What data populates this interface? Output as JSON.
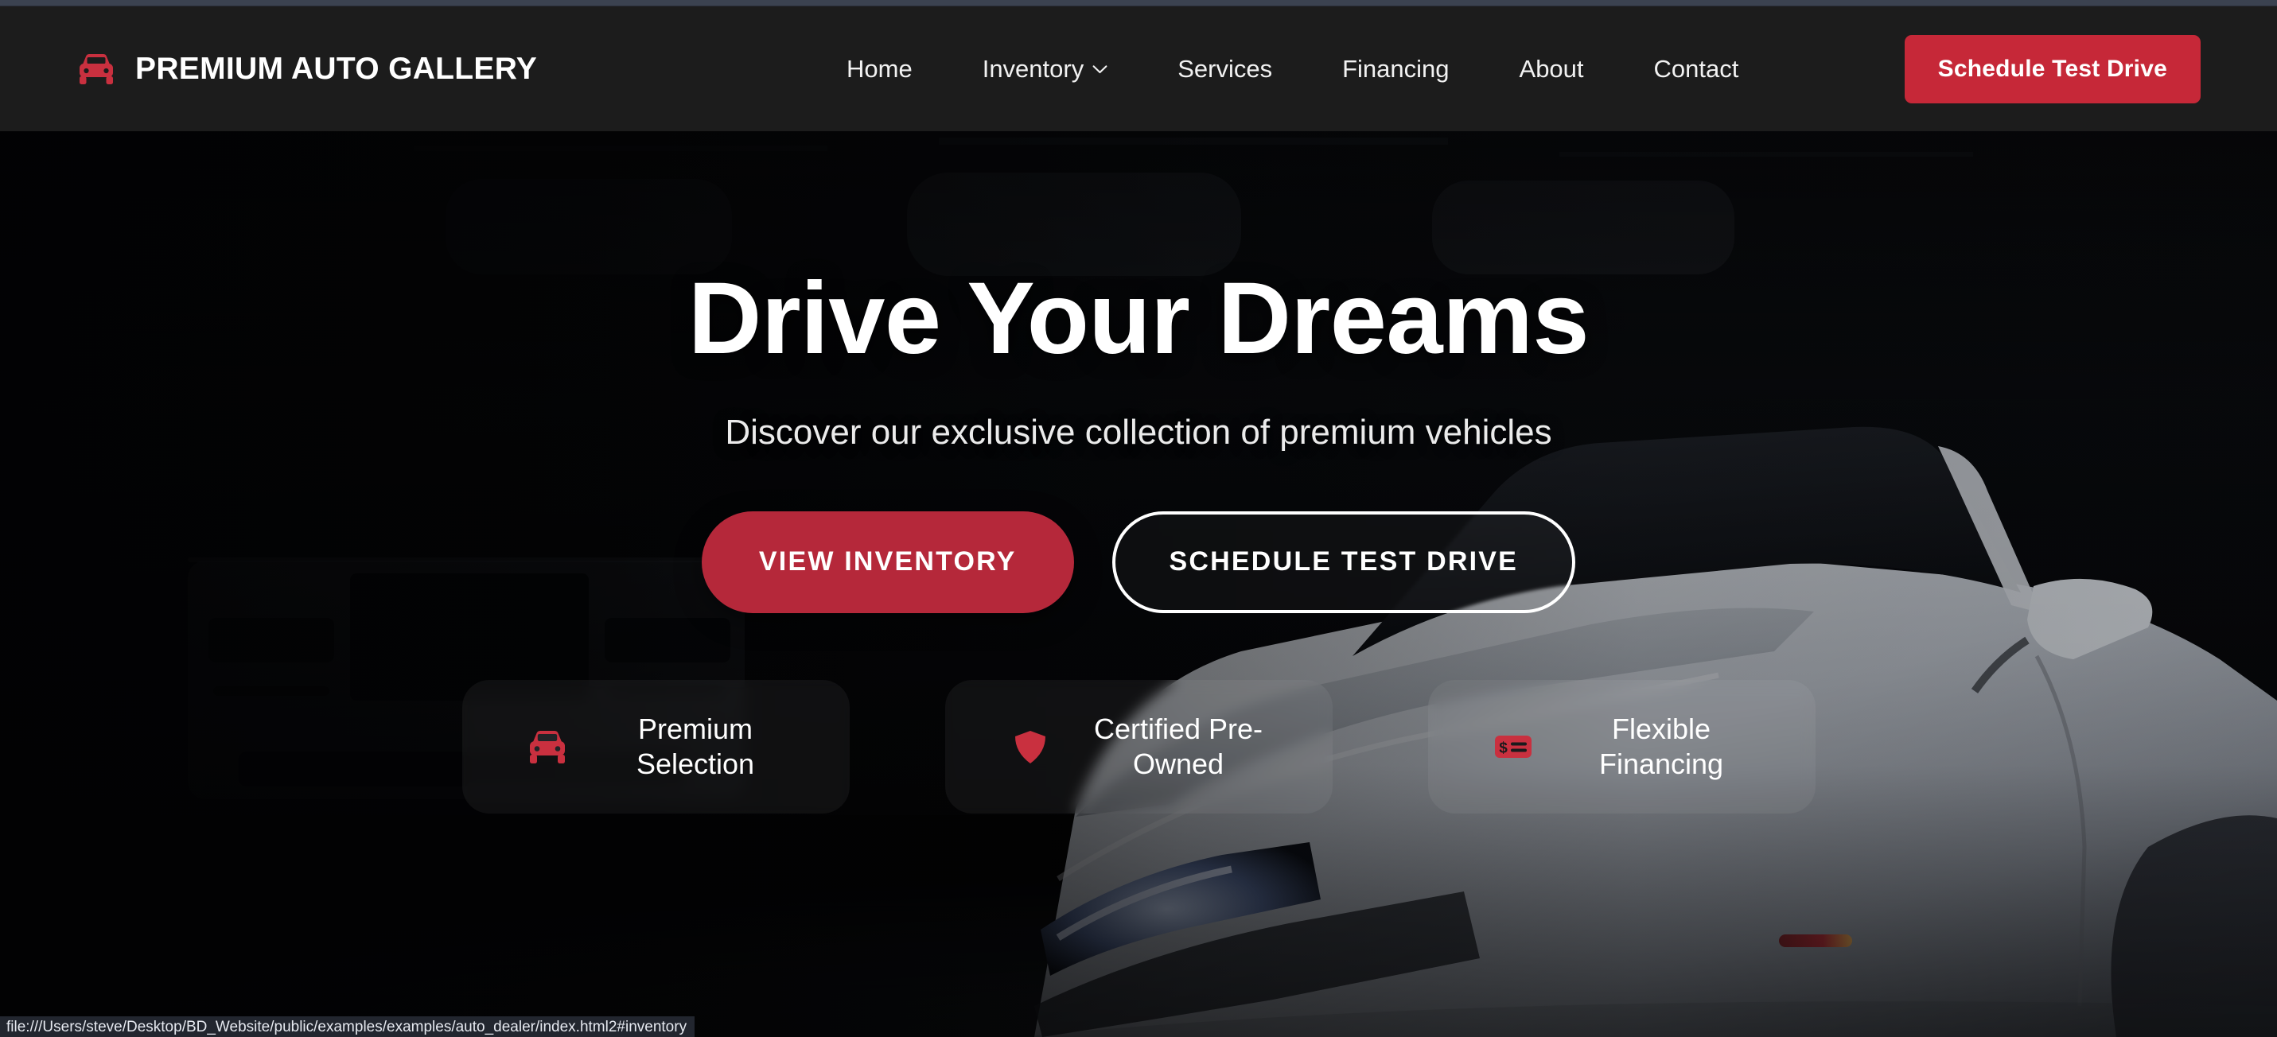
{
  "theme": {
    "brand_red": "#c62838",
    "hero_button_red": "#b5283a",
    "header_bg": "#1c1c1c",
    "icon_red": "#c9303f"
  },
  "header": {
    "logo_icon": "car-front-icon",
    "brand_name": "PREMIUM AUTO GALLERY",
    "nav": [
      {
        "label": "Home",
        "icon": null
      },
      {
        "label": "Inventory",
        "icon": "chevron-down-icon"
      },
      {
        "label": "Services",
        "icon": null
      },
      {
        "label": "Financing",
        "icon": null
      },
      {
        "label": "About",
        "icon": null
      },
      {
        "label": "Contact",
        "icon": null
      }
    ],
    "cta_label": "Schedule Test Drive"
  },
  "hero": {
    "title": "Drive Your Dreams",
    "subtitle": "Discover our exclusive collection of premium vehicles",
    "primary_button": "VIEW INVENTORY",
    "secondary_button": "SCHEDULE TEST DRIVE",
    "features": [
      {
        "icon": "car-front-icon",
        "label": "Premium Selection"
      },
      {
        "icon": "shield-icon",
        "label": "Certified Pre-Owned"
      },
      {
        "icon": "money-card-icon",
        "label": "Flexible Financing"
      }
    ]
  },
  "status_bar": {
    "url": "file:///Users/steve/Desktop/BD_Website/public/examples/examples/auto_dealer/index.html2#inventory"
  }
}
